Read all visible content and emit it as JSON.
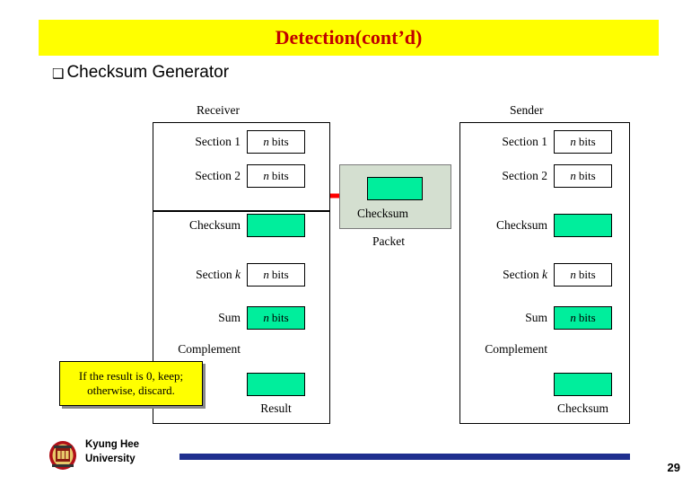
{
  "slide": {
    "title": "Detection(cont’d)",
    "title_bg": "#ffff00",
    "title_color": "#c00000",
    "bullet": {
      "marker": "❑",
      "text": "Checksum Generator"
    }
  },
  "figure": {
    "labels": {
      "receiver": "Receiver",
      "sender": "Sender",
      "packet": "Packet"
    },
    "sender": {
      "rows": [
        {
          "label": "Section 1",
          "value": "n bits",
          "value_style": "italic-n",
          "filled": false
        },
        {
          "label": "Section 2",
          "value": "n bits",
          "value_style": "italic-n",
          "filled": false
        },
        {
          "label": "Checksum",
          "value": "",
          "value_style": "blank",
          "filled": true
        },
        {
          "label": "Section k",
          "value": "n bits",
          "value_style": "italic-k-n",
          "filled": false
        },
        {
          "label": "Sum",
          "value": "n bits",
          "value_style": "italic-n",
          "filled": true
        },
        {
          "label": "Complement",
          "value": "",
          "value_style": "blank",
          "filled": true
        },
        {
          "label": "Checksum",
          "value": "",
          "value_style": "caption",
          "filled": false
        }
      ]
    },
    "receiver": {
      "rows": [
        {
          "label": "Section 1",
          "value": "n bits",
          "value_style": "italic-n",
          "filled": false
        },
        {
          "label": "Section 2",
          "value": "n bits",
          "value_style": "italic-n",
          "filled": false
        },
        {
          "label": "Checksum",
          "value": "",
          "value_style": "blank",
          "filled": true
        },
        {
          "label": "Section k",
          "value": "n bits",
          "value_style": "italic-k-n",
          "filled": false
        },
        {
          "label": "Sum",
          "value": "n bits",
          "value_style": "italic-n",
          "filled": true
        },
        {
          "label": "Complement",
          "value": "",
          "value_style": "blank",
          "filled": true
        },
        {
          "label": "Result",
          "value": "",
          "value_style": "caption",
          "filled": false
        }
      ]
    },
    "packet": {
      "caption": "Checksum"
    },
    "note": {
      "line1": "If the result is 0, keep;",
      "line2": "otherwise, discard."
    },
    "colors": {
      "green_fill": "#00ee9c",
      "packet_fill": "#d4dfd0",
      "arrow_red": "#ff0000",
      "note_fill": "#ffff00"
    }
  },
  "footer": {
    "university_line1": "Kyung Hee",
    "university_line2": "University",
    "page_number": "29",
    "rule_color": "#1f2f8f"
  }
}
